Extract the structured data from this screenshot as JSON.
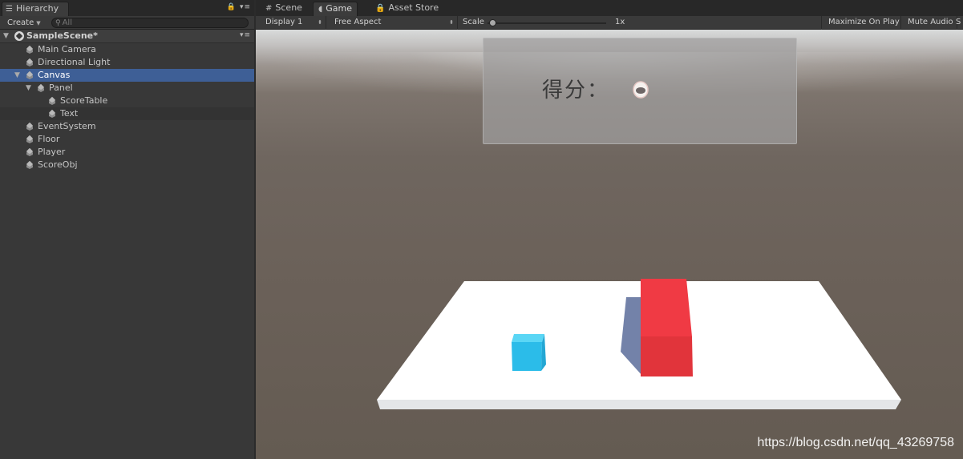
{
  "hierarchy": {
    "tab_label": "Hierarchy",
    "panel_menu": "▾≡",
    "create_label": "Create",
    "search_placeholder": "All",
    "scene_name": "SampleScene*",
    "items": [
      {
        "label": "Main Camera"
      },
      {
        "label": "Directional Light"
      },
      {
        "label": "Canvas"
      },
      {
        "label": "Panel"
      },
      {
        "label": "ScoreTable"
      },
      {
        "label": "Text"
      },
      {
        "label": "EventSystem"
      },
      {
        "label": "Floor"
      },
      {
        "label": "Player"
      },
      {
        "label": "ScoreObj"
      }
    ]
  },
  "tabs": {
    "scene": "Scene",
    "game": "Game",
    "asset_store": "Asset Store"
  },
  "game_toolbar": {
    "display": "Display 1",
    "aspect": "Free Aspect",
    "scale_label": "Scale",
    "scale_value": "1x",
    "maximize": "Maximize On Play",
    "mute": "Mute Audio",
    "stats_cut": "S"
  },
  "game_view": {
    "score_label": "得分：",
    "score_value": "0",
    "colors": {
      "floor": "#ffffff",
      "player": "#2fc6f0",
      "obstacle": "#ee3a43"
    }
  },
  "watermark": "https://blog.csdn.net/qq_43269758"
}
